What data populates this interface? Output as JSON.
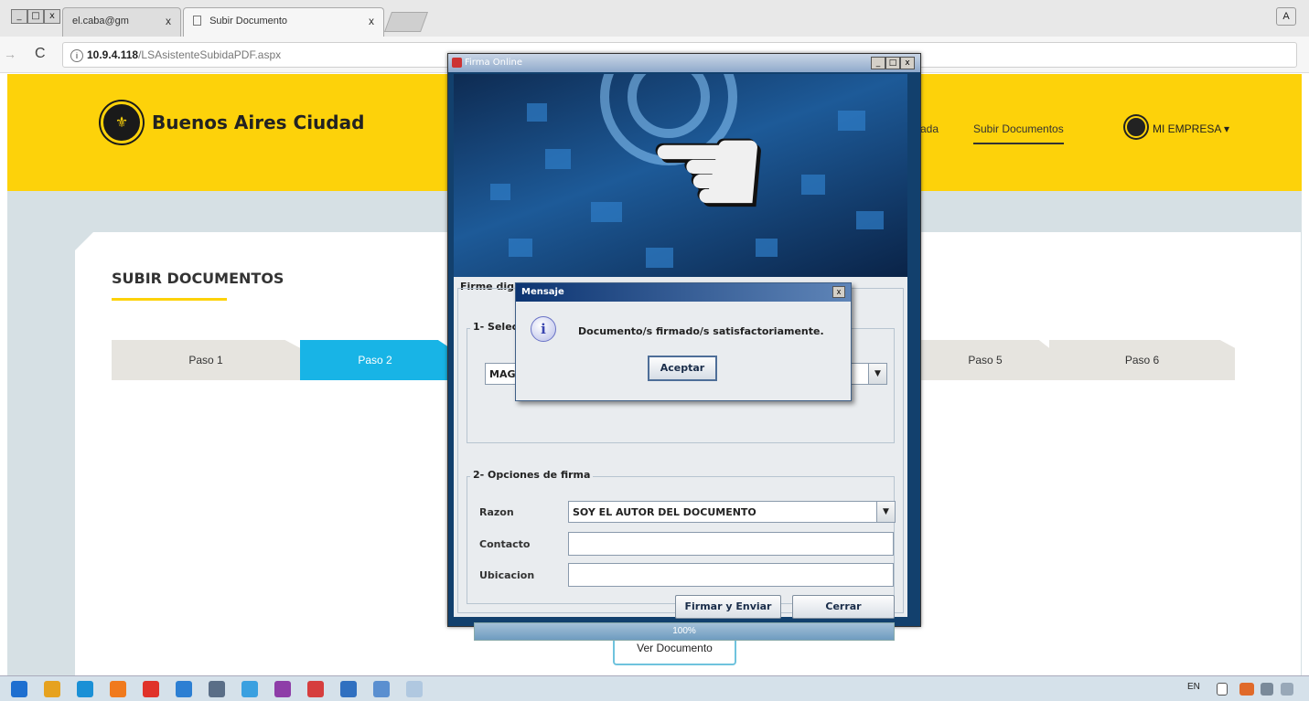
{
  "browser": {
    "window_controls": [
      "_",
      "□",
      "x"
    ],
    "tabs": [
      {
        "label": "el.caba@gm",
        "close": "x"
      },
      {
        "label": "Subir Documento",
        "close": "x"
      }
    ],
    "account_icon": "A",
    "url_host": "10.9.4.118",
    "url_path": "/LSAsistenteSubidaPDF.aspx",
    "forward_glyph": "→",
    "reload_glyph": "C",
    "info_glyph": "i"
  },
  "site": {
    "logo_text": "Buenos Aires Ciudad",
    "nav": [
      {
        "label": "ada"
      },
      {
        "label": "Subir Documentos"
      }
    ],
    "user_menu": "MI EMPRESA ▾",
    "page_title": "SUBIR DOCUMENTOS",
    "steps": [
      "Paso 1",
      "Paso 2",
      "Paso 5",
      "Paso 6"
    ],
    "view_document": "Ver Documento"
  },
  "firma_window": {
    "title": "Firma Online",
    "controls": [
      "_",
      "□",
      "x"
    ],
    "panel_title": "Firme digitalmente los documentos online",
    "section1_label": "1- Seleccion del certificado",
    "certificate_value": "MAG",
    "section2_label": "2- Opciones de firma",
    "razon_label": "Razon",
    "razon_value": "SOY EL AUTOR DEL DOCUMENTO",
    "contacto_label": "Contacto",
    "ubicacion_label": "Ubicacion",
    "sign_button": "Firmar y Enviar",
    "close_button": "Cerrar",
    "progress_percent": 100,
    "progress_text": "100%"
  },
  "message_dialog": {
    "title": "Mensaje",
    "close": "x",
    "icon_glyph": "i",
    "text": "Documento/s firmado/s satisfactoriamente.",
    "ok_button": "Aceptar"
  },
  "taskbar": {
    "language": "EN",
    "colors": [
      "#1e6fd0",
      "#e6a21f",
      "#1a90d6",
      "#f07a1d",
      "#e0322a",
      "#2c7fd3",
      "#5a6e87",
      "#3aa0e0",
      "#8e3da8",
      "#d63e3e",
      "#3070c0",
      "#5a8fd0",
      "#b0c8e0"
    ]
  },
  "colors": {
    "header_yellow": "#fdd20a",
    "step_active": "#18b4e6",
    "page_background": "#d6e0e4"
  }
}
